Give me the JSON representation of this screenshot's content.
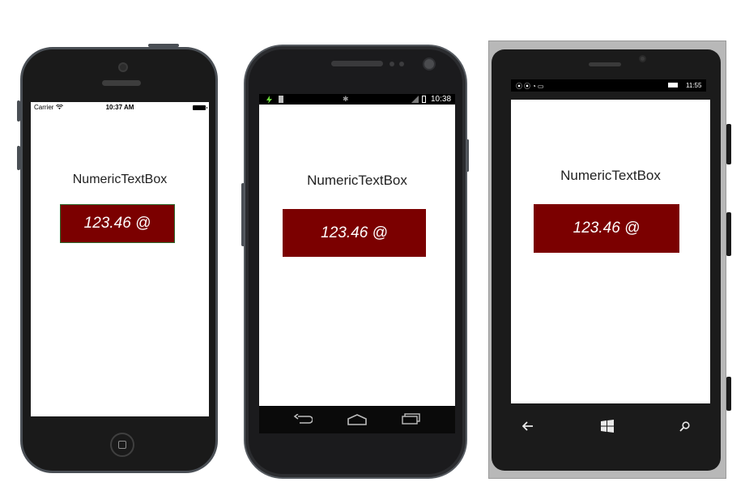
{
  "app": {
    "title": "NumericTextBox",
    "value_display": "123.46 @",
    "box_color": "#7b0000"
  },
  "ios": {
    "carrier": "Carrier",
    "wifi_icon": "wifi-icon",
    "time": "10:37 AM",
    "battery_icon": "battery-icon",
    "home_icon": "home-button-icon"
  },
  "android": {
    "time": "10:38",
    "status_icons": [
      "charging-icon",
      "sd-card-icon",
      "bluetooth-icon",
      "signal-icon",
      "battery-icon"
    ],
    "nav": {
      "back_icon": "back-icon",
      "home_icon": "home-icon",
      "recents_icon": "recents-icon"
    }
  },
  "windows_phone": {
    "time": "11:55",
    "nav": {
      "back_icon": "back-arrow-icon",
      "start_icon": "windows-logo-icon",
      "search_icon": "search-icon"
    }
  }
}
